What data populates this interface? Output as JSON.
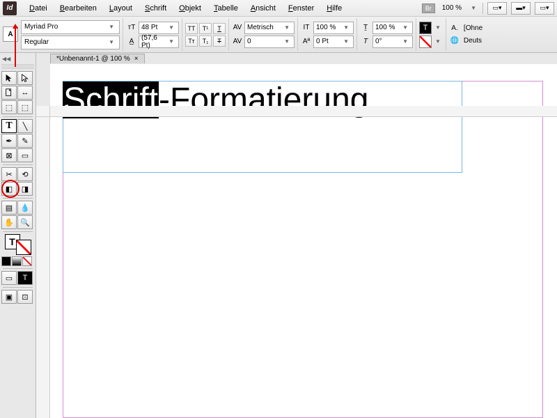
{
  "app": {
    "name": "Id"
  },
  "menu": {
    "items": [
      "Datei",
      "Bearbeiten",
      "Layout",
      "Schrift",
      "Objekt",
      "Tabelle",
      "Ansicht",
      "Fenster",
      "Hilfe"
    ],
    "bridge_badge": "Br",
    "zoom": "100 %"
  },
  "control": {
    "mode": "A",
    "font_family": "Myriad Pro",
    "font_style": "Regular",
    "font_size": "48 Pt",
    "leading": "(57,6 Pt)",
    "kerning_mode": "Metrisch",
    "tracking": "0",
    "vscale": "100 %",
    "hscale": "100 %",
    "baseline": "0 Pt",
    "skew": "0°",
    "tt_label": "TT",
    "allcaps": "TT",
    "smallcaps": "Tᴛ",
    "super": "T¹",
    "sub": "T₁",
    "underline": "T",
    "strike": "T",
    "fill_letter": "T",
    "a_label": "A.",
    "no_style": "[Ohne",
    "lang": "Deuts"
  },
  "doc": {
    "tab_title": "*Unbenannt-1 @ 100 %",
    "text_selected": "Schrift",
    "text_rest": "-Formatierung"
  },
  "tools": {
    "grid_icon": "▦",
    "t_icon": "T"
  }
}
